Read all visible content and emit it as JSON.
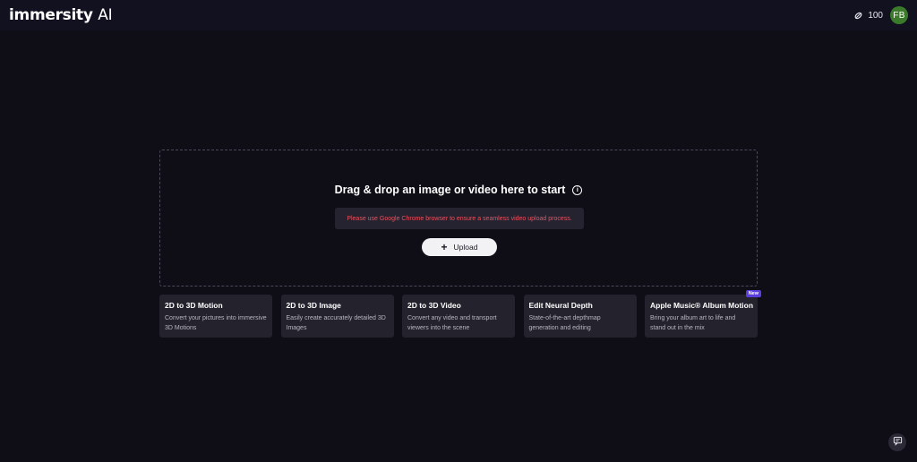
{
  "header": {
    "logo_main": "immersity",
    "logo_ai": "AI",
    "credits": "100",
    "avatar_initials": "FB"
  },
  "dropzone": {
    "title": "Drag & drop an image or video here to start",
    "warning": "Please use Google Chrome browser to ensure a seamless video upload process.",
    "upload_label": "Upload"
  },
  "cards": [
    {
      "title": "2D to 3D Motion",
      "desc": "Convert your pictures into immersive 3D Motions"
    },
    {
      "title": "2D to 3D Image",
      "desc": "Easily create accurately detailed 3D Images"
    },
    {
      "title": "2D to 3D Video",
      "desc": "Convert any video and transport viewers into the scene"
    },
    {
      "title": "Edit Neural Depth",
      "desc": "State-of-the-art depthmap generation and editing"
    },
    {
      "title": "Apple Music® Album Motion",
      "desc": "Bring your album art to life and stand out in the mix",
      "badge": "New"
    }
  ],
  "colors": {
    "background": "#0f0e17",
    "topbar": "#121120",
    "card": "#23222d",
    "warning_text": "#ef4f5d",
    "badge": "#5b3de0",
    "avatar": "#3b7a2a"
  },
  "icons": {
    "credits": "token-icon",
    "info": "info-icon",
    "upload": "plus-icon",
    "chat": "chat-icon"
  }
}
